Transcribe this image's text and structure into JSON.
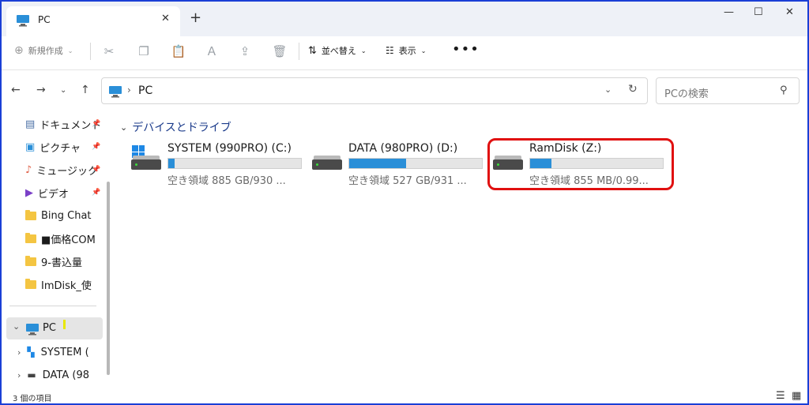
{
  "window": {
    "tab_title": "PC",
    "close_tab_glyph": "✕",
    "new_tab_glyph": "+",
    "minimize_glyph": "—",
    "maximize_glyph": "☐",
    "close_glyph": "✕"
  },
  "toolbar": {
    "new_label": "新規作成",
    "sort_label": "並べ替え",
    "view_label": "表示",
    "more_label": "•••"
  },
  "address": {
    "path": "PC",
    "search_placeholder": "PCの検索"
  },
  "sidebar": {
    "pinned": [
      {
        "label": "ドキュメント"
      },
      {
        "label": "ピクチャ"
      },
      {
        "label": "ミュージック"
      },
      {
        "label": "ビデオ"
      }
    ],
    "folders": [
      {
        "label": "Bing Chat"
      },
      {
        "label": "■価格COM"
      },
      {
        "label": "9-書込量"
      },
      {
        "label": "ImDisk_使"
      }
    ],
    "pc_label": "PC",
    "drives": [
      {
        "label": "SYSTEM ("
      },
      {
        "label": "DATA (98"
      }
    ]
  },
  "main": {
    "group_title": "デバイスとドライブ",
    "drives": [
      {
        "name": "SYSTEM (990PRO) (C:)",
        "free_text": "空き領域 885 GB/930 ...",
        "used_fraction": 0.05
      },
      {
        "name": "DATA (980PRO) (D:)",
        "free_text": "空き領域 527 GB/931 ...",
        "used_fraction": 0.43
      },
      {
        "name": "RamDisk (Z:)",
        "free_text": "空き領域 855 MB/0.99...",
        "used_fraction": 0.16
      }
    ]
  },
  "status": {
    "item_count": "3 個の項目"
  },
  "colors": {
    "accent": "#2a8fd8",
    "highlight": "#e01010",
    "frame": "#1a3fd6"
  }
}
